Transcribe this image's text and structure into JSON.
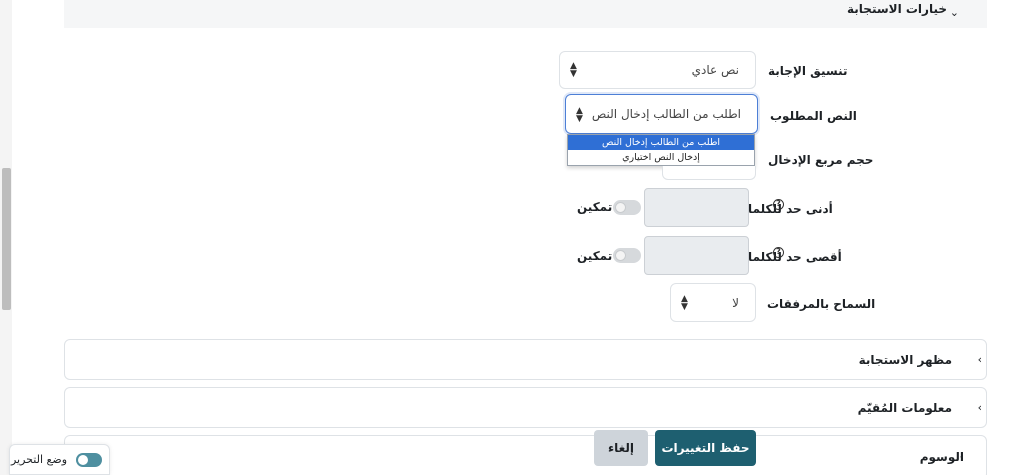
{
  "section": {
    "title": "خيارات الاستجابة"
  },
  "fields": {
    "response_format": {
      "label": "تنسيق الإجابة",
      "value": "نص عادي"
    },
    "required_text": {
      "label": "النص المطلوب",
      "value": "اطلب من الطالب إدخال النص",
      "options": [
        "اطلب من الطالب إدخال النص",
        "إدخال النص اختياري"
      ],
      "selected_index": 0
    },
    "input_box_size": {
      "label": "حجم مربع الإدخال"
    },
    "min_words": {
      "label": "أدنى حد للكلمات",
      "toggle_label": "تمكين",
      "help_icon": "?"
    },
    "max_words": {
      "label": "أقصى حد للكلمات",
      "toggle_label": "تمكين",
      "help_icon": "?"
    },
    "allow_attachments": {
      "label": "السماح بالمرفقات",
      "value": "لا"
    }
  },
  "collapsed_sections": [
    {
      "title": "مظهر الاستجابة"
    },
    {
      "title": "معلومات المُقيّم"
    },
    {
      "title": "الوسوم"
    }
  ],
  "buttons": {
    "save": "حفظ التغييرات",
    "cancel": "إلغاء"
  },
  "edit_mode": {
    "label": "وضع التحرير",
    "enabled": true
  },
  "colors": {
    "primary": "#1e5f70",
    "focus": "#4d7fd6",
    "dropdown_highlight": "#2f6fd5"
  }
}
